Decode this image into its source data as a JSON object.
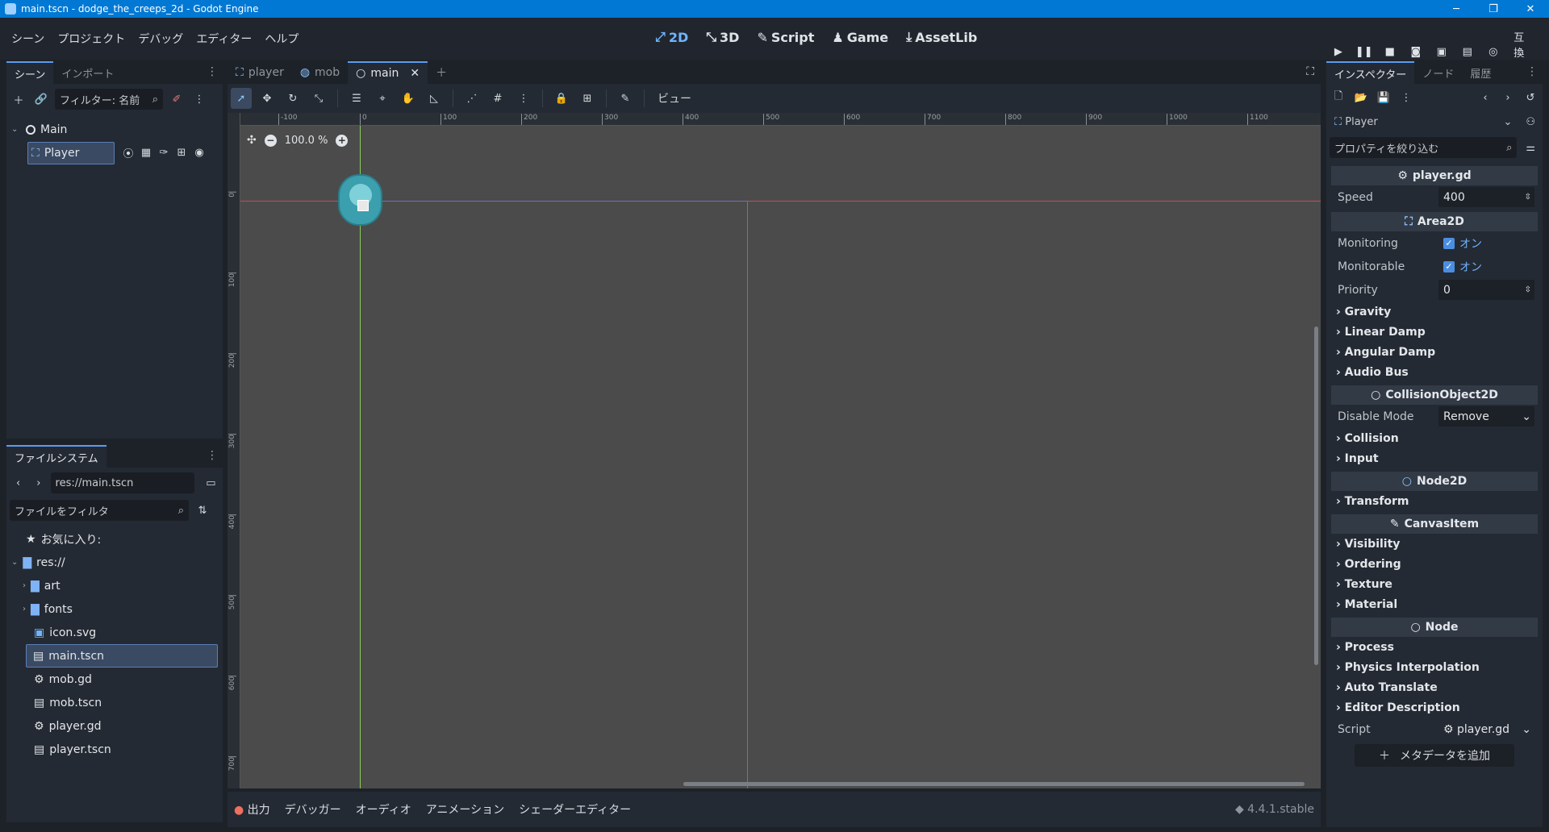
{
  "window": {
    "title": "main.tscn - dodge_the_creeps_2d - Godot Engine"
  },
  "menu": [
    "シーン",
    "プロジェクト",
    "デバッグ",
    "エディター",
    "ヘルプ"
  ],
  "workspaces": [
    {
      "label": "2D",
      "active": true
    },
    {
      "label": "3D",
      "active": false
    },
    {
      "label": "Script",
      "active": false
    },
    {
      "label": "Game",
      "active": false
    },
    {
      "label": "AssetLib",
      "active": false
    }
  ],
  "compat_label": "互換性",
  "scene_dock": {
    "tabs": [
      "シーン",
      "インポート"
    ],
    "filter_placeholder": "フィルター: 名前",
    "nodes": [
      {
        "label": "Main"
      },
      {
        "label": "Player"
      }
    ]
  },
  "filesystem": {
    "tab": "ファイルシステム",
    "path": "res://main.tscn",
    "filter_placeholder": "ファイルをフィルタ",
    "favorites": "お気に入り:",
    "root": "res://",
    "items": [
      "art",
      "fonts",
      "icon.svg",
      "main.tscn",
      "mob.gd",
      "mob.tscn",
      "player.gd",
      "player.tscn"
    ]
  },
  "editor_tabs": [
    "player",
    "mob",
    "main"
  ],
  "toolbar": {
    "view_label": "ビュー"
  },
  "viewport": {
    "zoom": "100.0 %",
    "ruler_top": [
      "-100",
      "0",
      "100",
      "200",
      "300",
      "400",
      "500",
      "600",
      "700",
      "800",
      "900",
      "1000",
      "1100"
    ],
    "ruler_left": [
      "0",
      "100",
      "200",
      "300",
      "400",
      "500",
      "600",
      "700"
    ]
  },
  "bottom": {
    "tabs": [
      "出力",
      "デバッガー",
      "オーディオ",
      "アニメーション",
      "シェーダーエディター"
    ],
    "version": "4.4.1.stable"
  },
  "inspector": {
    "tabs": [
      "インスペクター",
      "ノード",
      "履歴"
    ],
    "node": "Player",
    "filter_placeholder": "プロパティを絞り込む",
    "script_section": "player.gd",
    "speed_label": "Speed",
    "speed_value": "400",
    "area_section": "Area2D",
    "monitoring_label": "Monitoring",
    "monitoring_value": "オン",
    "monitorable_label": "Monitorable",
    "monitorable_value": "オン",
    "priority_label": "Priority",
    "priority_value": "0",
    "area_groups": [
      "Gravity",
      "Linear Damp",
      "Angular Damp",
      "Audio Bus"
    ],
    "collision_section": "CollisionObject2D",
    "disable_mode_label": "Disable Mode",
    "disable_mode_value": "Remove",
    "collision_groups": [
      "Collision",
      "Input"
    ],
    "node2d_section": "Node2D",
    "node2d_groups": [
      "Transform"
    ],
    "canvas_section": "CanvasItem",
    "canvas_groups": [
      "Visibility",
      "Ordering",
      "Texture",
      "Material"
    ],
    "node_section": "Node",
    "node_groups": [
      "Process",
      "Physics Interpolation",
      "Auto Translate",
      "Editor Description"
    ],
    "script_label": "Script",
    "script_value": "player.gd",
    "add_metadata": "メタデータを追加"
  },
  "colors": {
    "accent": "#5c9bf0",
    "viewport_bg": "#4b4b4b",
    "panel_bg": "#242a33"
  }
}
